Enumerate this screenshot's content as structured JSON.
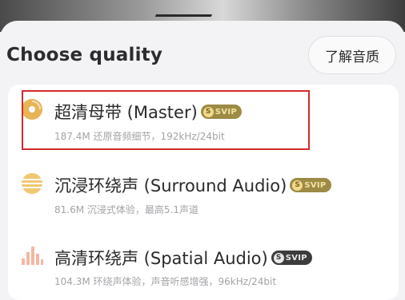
{
  "sheet": {
    "title": "Choose quality",
    "learn_button": "了解音质"
  },
  "options": [
    {
      "title": "超清母带 (Master)",
      "badge": "SVIP",
      "description": "187.4M  还原音频细节，192kHz/24bit",
      "icon": "disc-icon",
      "selected": true
    },
    {
      "title": "沉浸环绕声 (Surround Audio)",
      "badge": "SVIP",
      "description": "81.6M  沉浸式体验，最高5.1声道",
      "icon": "surround-sphere-icon",
      "selected": false
    },
    {
      "title": "高清环绕声 (Spatial Audio)",
      "badge": "SVIP",
      "description": "104.3M  环绕声体验，声音听感增强，96kHz/24bit",
      "icon": "spatial-bars-icon",
      "selected": false
    }
  ],
  "colors": {
    "accent_gold": "#e8b455",
    "accent_peach": "#f3b8a3",
    "highlight_border": "#d22a2a"
  }
}
